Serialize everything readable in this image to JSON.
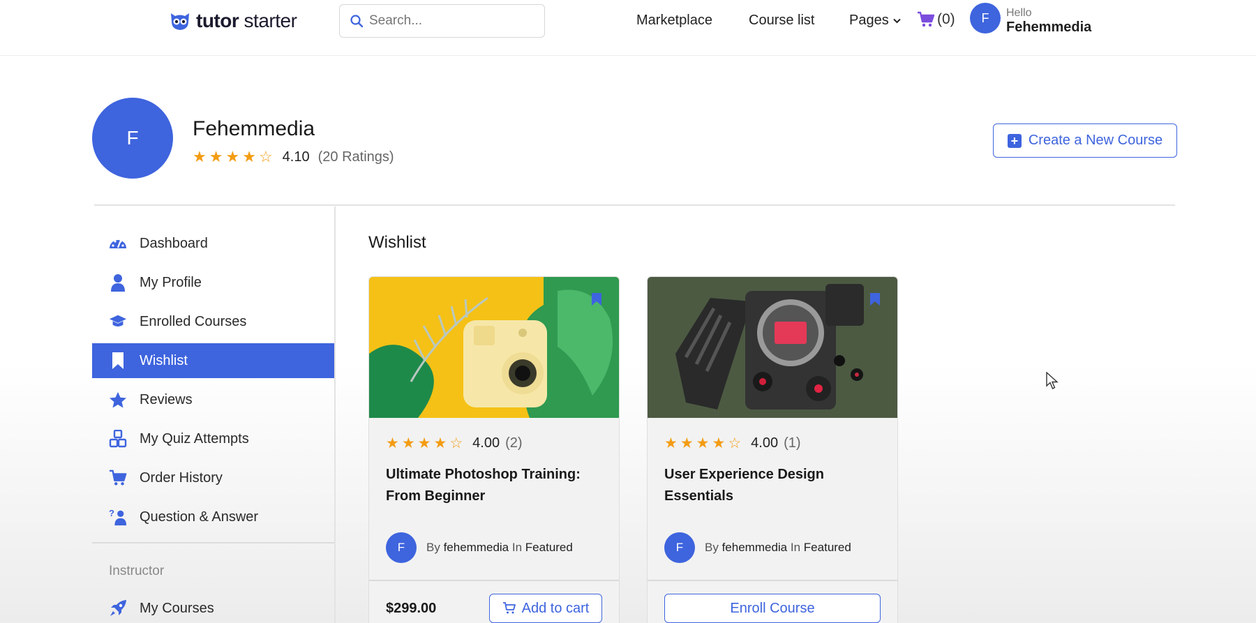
{
  "header": {
    "logo_bold": "tutor",
    "logo_light": "starter",
    "search_placeholder": "Search...",
    "nav": [
      "Marketplace",
      "Course list",
      "Pages"
    ],
    "cart_count": "(0)",
    "user_initial": "F",
    "hello_label": "Hello",
    "user_name": "Fehemmedia"
  },
  "profile": {
    "initial": "F",
    "name": "Fehemmedia",
    "rating_value": "4.10",
    "rating_count": "(20 Ratings)",
    "stars": 4.1,
    "create_button": "Create a New Course"
  },
  "sidebar": {
    "items": [
      {
        "label": "Dashboard",
        "icon": "gauge-icon"
      },
      {
        "label": "My Profile",
        "icon": "user-icon"
      },
      {
        "label": "Enrolled Courses",
        "icon": "graduation-cap-icon"
      },
      {
        "label": "Wishlist",
        "icon": "bookmark-icon",
        "active": true
      },
      {
        "label": "Reviews",
        "icon": "star-icon"
      },
      {
        "label": "My Quiz Attempts",
        "icon": "quiz-blocks-icon"
      },
      {
        "label": "Order History",
        "icon": "cart-icon"
      },
      {
        "label": "Question & Answer",
        "icon": "question-person-icon"
      }
    ],
    "instructor_heading": "Instructor",
    "instructor_items": [
      {
        "label": "My Courses",
        "icon": "rocket-icon"
      }
    ]
  },
  "main": {
    "title": "Wishlist",
    "cards": [
      {
        "rating_value": "4.00",
        "rating_count": "(2)",
        "stars": 4,
        "title": "Ultimate Photoshop Training: From Beginner",
        "author_initial": "F",
        "by": "By",
        "author": "fehemmedia",
        "in": "In",
        "category": "Featured",
        "price": "$299.00",
        "button": "Add to cart"
      },
      {
        "rating_value": "4.00",
        "rating_count": "(1)",
        "stars": 4,
        "title": "User Experience Design Essentials",
        "author_initial": "F",
        "by": "By",
        "author": "fehemmedia",
        "in": "In",
        "category": "Featured",
        "button": "Enroll Course"
      }
    ]
  },
  "colors": {
    "accent": "#3e64de",
    "star": "#f39c12",
    "cart": "#7b4dde"
  }
}
